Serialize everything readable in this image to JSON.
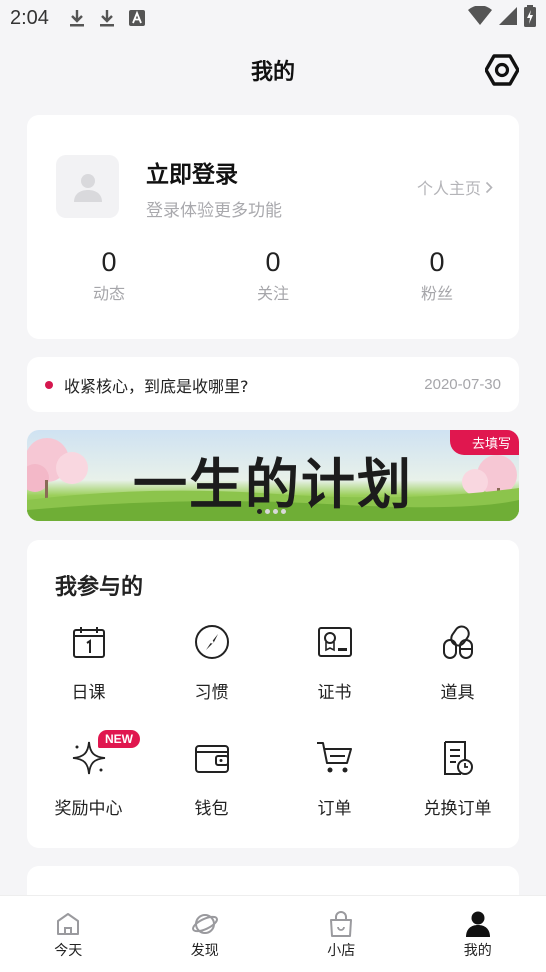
{
  "status_bar": {
    "time": "2:04"
  },
  "header": {
    "title": "我的"
  },
  "profile": {
    "login_title": "立即登录",
    "login_subtitle": "登录体验更多功能",
    "homepage_link": "个人主页",
    "stats": [
      {
        "value": "0",
        "label": "动态"
      },
      {
        "value": "0",
        "label": "关注"
      },
      {
        "value": "0",
        "label": "粉丝"
      }
    ]
  },
  "notice": {
    "text": "收紧核心，到底是收哪里?",
    "date": "2020-07-30"
  },
  "banner": {
    "title": "一生的计划",
    "tag": "去填写",
    "page_count": 4,
    "active_page": 1
  },
  "participate": {
    "heading": "我参与的",
    "items": [
      {
        "label": "日课",
        "icon": "calendar-icon"
      },
      {
        "label": "习惯",
        "icon": "compass-icon"
      },
      {
        "label": "证书",
        "icon": "certificate-icon"
      },
      {
        "label": "道具",
        "icon": "pills-icon"
      },
      {
        "label": "奖励中心",
        "icon": "sparkle-icon",
        "badge": "NEW"
      },
      {
        "label": "钱包",
        "icon": "wallet-icon"
      },
      {
        "label": "订单",
        "icon": "cart-icon"
      },
      {
        "label": "兑换订单",
        "icon": "receipt-clock-icon"
      }
    ]
  },
  "tabbar": {
    "items": [
      {
        "label": "今天",
        "icon": "home-icon"
      },
      {
        "label": "发现",
        "icon": "planet-icon"
      },
      {
        "label": "小店",
        "icon": "shopping-bag-icon"
      },
      {
        "label": "我的",
        "icon": "person-icon",
        "active": true
      }
    ]
  },
  "colors": {
    "accent": "#e0174f",
    "notice_dot": "#d5174e",
    "muted_text": "#a6a6aa"
  }
}
